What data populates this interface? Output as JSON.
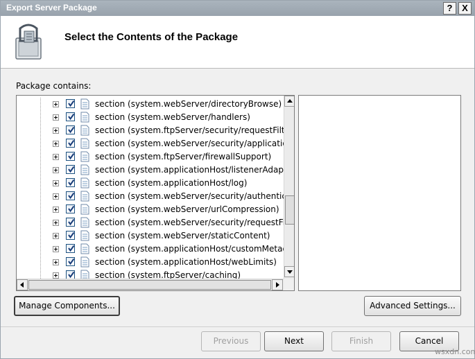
{
  "window": {
    "title": "Export Server Package",
    "help_button": "?",
    "close_button": "X"
  },
  "header": {
    "title": "Select the Contents of the Package",
    "icon": "package-icon"
  },
  "package_label": "Package contains:",
  "tree": {
    "items": [
      {
        "label": "section (system.webServer/directoryBrowse)",
        "checked": true
      },
      {
        "label": "section (system.webServer/handlers)",
        "checked": true
      },
      {
        "label": "section (system.ftpServer/security/requestFilte",
        "checked": true
      },
      {
        "label": "section (system.webServer/security/application",
        "checked": true
      },
      {
        "label": "section (system.ftpServer/firewallSupport)",
        "checked": true
      },
      {
        "label": "section (system.applicationHost/listenerAdapter",
        "checked": true
      },
      {
        "label": "section (system.applicationHost/log)",
        "checked": true
      },
      {
        "label": "section (system.webServer/security/authentica",
        "checked": true
      },
      {
        "label": "section (system.webServer/urlCompression)",
        "checked": true
      },
      {
        "label": "section (system.webServer/security/requestFilt",
        "checked": true
      },
      {
        "label": "section (system.webServer/staticContent)",
        "checked": true
      },
      {
        "label": "section (system.applicationHost/customMetada",
        "checked": true
      },
      {
        "label": "section (system.applicationHost/webLimits)",
        "checked": true
      },
      {
        "label": "section (system.ftpServer/caching)",
        "checked": true
      }
    ]
  },
  "buttons": {
    "manage_components": "Manage Components...",
    "advanced_settings": "Advanced Settings...",
    "previous": "Previous",
    "next": "Next",
    "finish": "Finish",
    "cancel": "Cancel"
  },
  "watermark": "wsxdn.com"
}
